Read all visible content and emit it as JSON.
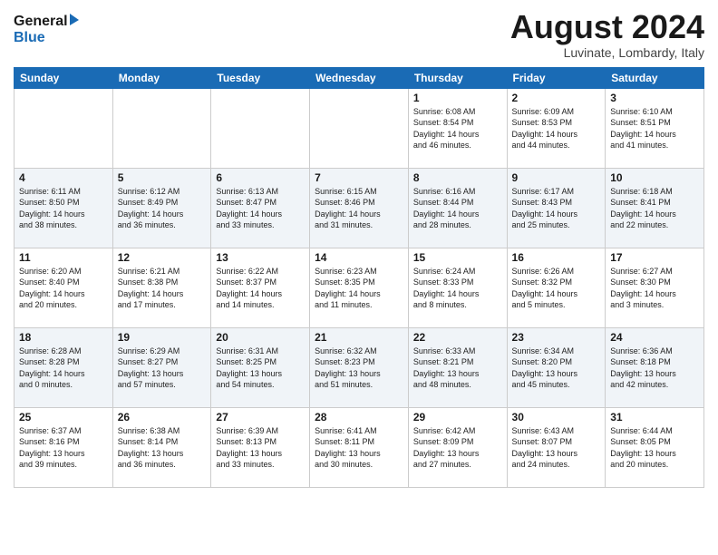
{
  "logo": {
    "line1": "General",
    "line2": "Blue"
  },
  "title": "August 2024",
  "subtitle": "Luvinate, Lombardy, Italy",
  "weekdays": [
    "Sunday",
    "Monday",
    "Tuesday",
    "Wednesday",
    "Thursday",
    "Friday",
    "Saturday"
  ],
  "weeks": [
    [
      {
        "day": "",
        "info": ""
      },
      {
        "day": "",
        "info": ""
      },
      {
        "day": "",
        "info": ""
      },
      {
        "day": "",
        "info": ""
      },
      {
        "day": "1",
        "info": "Sunrise: 6:08 AM\nSunset: 8:54 PM\nDaylight: 14 hours\nand 46 minutes."
      },
      {
        "day": "2",
        "info": "Sunrise: 6:09 AM\nSunset: 8:53 PM\nDaylight: 14 hours\nand 44 minutes."
      },
      {
        "day": "3",
        "info": "Sunrise: 6:10 AM\nSunset: 8:51 PM\nDaylight: 14 hours\nand 41 minutes."
      }
    ],
    [
      {
        "day": "4",
        "info": "Sunrise: 6:11 AM\nSunset: 8:50 PM\nDaylight: 14 hours\nand 38 minutes."
      },
      {
        "day": "5",
        "info": "Sunrise: 6:12 AM\nSunset: 8:49 PM\nDaylight: 14 hours\nand 36 minutes."
      },
      {
        "day": "6",
        "info": "Sunrise: 6:13 AM\nSunset: 8:47 PM\nDaylight: 14 hours\nand 33 minutes."
      },
      {
        "day": "7",
        "info": "Sunrise: 6:15 AM\nSunset: 8:46 PM\nDaylight: 14 hours\nand 31 minutes."
      },
      {
        "day": "8",
        "info": "Sunrise: 6:16 AM\nSunset: 8:44 PM\nDaylight: 14 hours\nand 28 minutes."
      },
      {
        "day": "9",
        "info": "Sunrise: 6:17 AM\nSunset: 8:43 PM\nDaylight: 14 hours\nand 25 minutes."
      },
      {
        "day": "10",
        "info": "Sunrise: 6:18 AM\nSunset: 8:41 PM\nDaylight: 14 hours\nand 22 minutes."
      }
    ],
    [
      {
        "day": "11",
        "info": "Sunrise: 6:20 AM\nSunset: 8:40 PM\nDaylight: 14 hours\nand 20 minutes."
      },
      {
        "day": "12",
        "info": "Sunrise: 6:21 AM\nSunset: 8:38 PM\nDaylight: 14 hours\nand 17 minutes."
      },
      {
        "day": "13",
        "info": "Sunrise: 6:22 AM\nSunset: 8:37 PM\nDaylight: 14 hours\nand 14 minutes."
      },
      {
        "day": "14",
        "info": "Sunrise: 6:23 AM\nSunset: 8:35 PM\nDaylight: 14 hours\nand 11 minutes."
      },
      {
        "day": "15",
        "info": "Sunrise: 6:24 AM\nSunset: 8:33 PM\nDaylight: 14 hours\nand 8 minutes."
      },
      {
        "day": "16",
        "info": "Sunrise: 6:26 AM\nSunset: 8:32 PM\nDaylight: 14 hours\nand 5 minutes."
      },
      {
        "day": "17",
        "info": "Sunrise: 6:27 AM\nSunset: 8:30 PM\nDaylight: 14 hours\nand 3 minutes."
      }
    ],
    [
      {
        "day": "18",
        "info": "Sunrise: 6:28 AM\nSunset: 8:28 PM\nDaylight: 14 hours\nand 0 minutes."
      },
      {
        "day": "19",
        "info": "Sunrise: 6:29 AM\nSunset: 8:27 PM\nDaylight: 13 hours\nand 57 minutes."
      },
      {
        "day": "20",
        "info": "Sunrise: 6:31 AM\nSunset: 8:25 PM\nDaylight: 13 hours\nand 54 minutes."
      },
      {
        "day": "21",
        "info": "Sunrise: 6:32 AM\nSunset: 8:23 PM\nDaylight: 13 hours\nand 51 minutes."
      },
      {
        "day": "22",
        "info": "Sunrise: 6:33 AM\nSunset: 8:21 PM\nDaylight: 13 hours\nand 48 minutes."
      },
      {
        "day": "23",
        "info": "Sunrise: 6:34 AM\nSunset: 8:20 PM\nDaylight: 13 hours\nand 45 minutes."
      },
      {
        "day": "24",
        "info": "Sunrise: 6:36 AM\nSunset: 8:18 PM\nDaylight: 13 hours\nand 42 minutes."
      }
    ],
    [
      {
        "day": "25",
        "info": "Sunrise: 6:37 AM\nSunset: 8:16 PM\nDaylight: 13 hours\nand 39 minutes."
      },
      {
        "day": "26",
        "info": "Sunrise: 6:38 AM\nSunset: 8:14 PM\nDaylight: 13 hours\nand 36 minutes."
      },
      {
        "day": "27",
        "info": "Sunrise: 6:39 AM\nSunset: 8:13 PM\nDaylight: 13 hours\nand 33 minutes."
      },
      {
        "day": "28",
        "info": "Sunrise: 6:41 AM\nSunset: 8:11 PM\nDaylight: 13 hours\nand 30 minutes."
      },
      {
        "day": "29",
        "info": "Sunrise: 6:42 AM\nSunset: 8:09 PM\nDaylight: 13 hours\nand 27 minutes."
      },
      {
        "day": "30",
        "info": "Sunrise: 6:43 AM\nSunset: 8:07 PM\nDaylight: 13 hours\nand 24 minutes."
      },
      {
        "day": "31",
        "info": "Sunrise: 6:44 AM\nSunset: 8:05 PM\nDaylight: 13 hours\nand 20 minutes."
      }
    ]
  ]
}
